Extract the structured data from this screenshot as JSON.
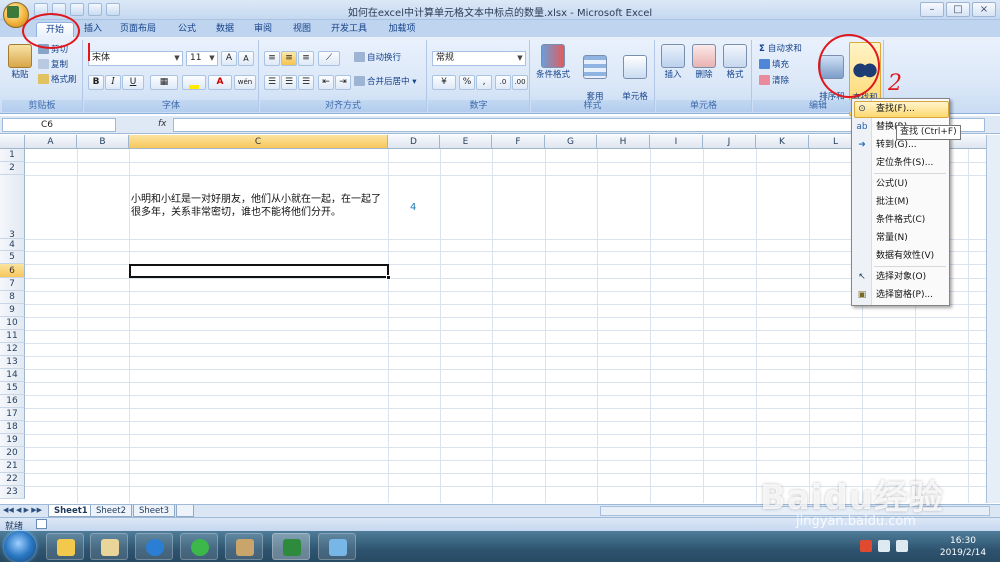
{
  "window": {
    "title": "如何在excel中计算单元格文本中标点的数量.xlsx - Microsoft Excel",
    "controls": [
      "–",
      "□",
      "×"
    ]
  },
  "tabs": [
    {
      "label": "开始",
      "active": true
    },
    {
      "label": "插入"
    },
    {
      "label": "页面布局"
    },
    {
      "label": "公式"
    },
    {
      "label": "数据"
    },
    {
      "label": "审阅"
    },
    {
      "label": "视图"
    },
    {
      "label": "开发工具"
    },
    {
      "label": "加载项"
    }
  ],
  "ribbon": {
    "clipboard": {
      "paste": "粘贴",
      "cut": "剪切",
      "copy": "复制",
      "format_painter": "格式刷",
      "label": "剪贴板"
    },
    "font": {
      "name": "宋体",
      "size": "11",
      "bold": "B",
      "italic": "I",
      "underline": "U",
      "grow": "A",
      "shrink": "A",
      "font_color": "A",
      "wen": "wén",
      "label": "字体"
    },
    "alignment": {
      "wrap": "自动换行",
      "merge": "合并后居中",
      "label": "对齐方式"
    },
    "number": {
      "format": "常规",
      "percent": "%",
      "comma": ",",
      "label": "数字"
    },
    "styles": {
      "conditional": "条件格式",
      "table": "套用\n表格格式",
      "cell": "单元格\n样式",
      "label": "样式"
    },
    "cells": {
      "insert": "插入",
      "delete": "删除",
      "format": "格式",
      "label": "单元格"
    },
    "editing": {
      "autosum": "自动求和",
      "fill": "填充",
      "clear": "清除",
      "sort": "排序和\n筛选",
      "find": "查找和\n选择",
      "label": "编辑"
    }
  },
  "formula_bar": {
    "name_box": "C6",
    "fx": "fx",
    "value": ""
  },
  "grid": {
    "columns": [
      "A",
      "B",
      "C",
      "D",
      "E",
      "F",
      "G",
      "H",
      "I",
      "J",
      "K",
      "L"
    ],
    "selected_column": "C",
    "rows": [
      "1",
      "2",
      "3",
      "4",
      "5",
      "6",
      "7",
      "8",
      "9",
      "10",
      "11",
      "12",
      "13",
      "14",
      "15",
      "16",
      "17",
      "18",
      "19",
      "20",
      "21",
      "22",
      "23"
    ],
    "selected_row": "6",
    "cell_c3": "小明和小红是一对好朋友，他们从小就在一起，在一起了很多年，关系非常密切，谁也不能将他们分开。",
    "cell_d3": "4"
  },
  "find_menu": {
    "items": [
      {
        "label": "查找(F)...",
        "icon": "binoculars-icon"
      },
      {
        "label": "替换(R)...",
        "icon": "replace-icon"
      },
      {
        "label": "转到(G)...",
        "icon": "arrow-right-icon"
      },
      {
        "label": "定位条件(S)..."
      },
      {
        "label": "公式(U)"
      },
      {
        "label": "批注(M)"
      },
      {
        "label": "条件格式(C)"
      },
      {
        "label": "常量(N)"
      },
      {
        "label": "数据有效性(V)"
      },
      {
        "label": "选择对象(O)",
        "icon": "cursor-icon"
      },
      {
        "label": "选择窗格(P)...",
        "icon": "pane-icon"
      }
    ],
    "tooltip": "查找 (Ctrl+F)"
  },
  "sheets": [
    "Sheet1",
    "Sheet2",
    "Sheet3"
  ],
  "status": {
    "text": "就绪"
  },
  "taskbar": {
    "time": "16:30",
    "date": "2019/2/14"
  },
  "annotation": {
    "number": "2"
  },
  "watermark": {
    "brand": "Baidu经验",
    "url": "jingyan.baidu.com"
  },
  "colors": {
    "accent": "#15428b",
    "selection": "#f8c75b",
    "annotation": "#e0171c"
  }
}
